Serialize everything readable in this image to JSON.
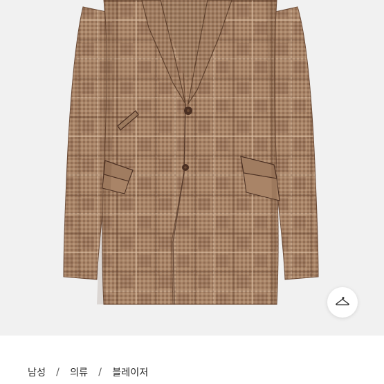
{
  "product_image": {
    "alt": "",
    "background": "#f1f1f1",
    "colors": {
      "jacket_base": "#a98467",
      "jacket_shadow": "#8c6a50",
      "check_dark": "#5d3f2b",
      "check_light": "#d2b49a",
      "button": "#4a2f22"
    }
  },
  "hanger_button": {
    "icon": "hanger-icon"
  },
  "breadcrumb": {
    "items": [
      {
        "label": "남성"
      },
      {
        "label": "의류"
      },
      {
        "label": "블레이저"
      }
    ],
    "separator": "/"
  }
}
